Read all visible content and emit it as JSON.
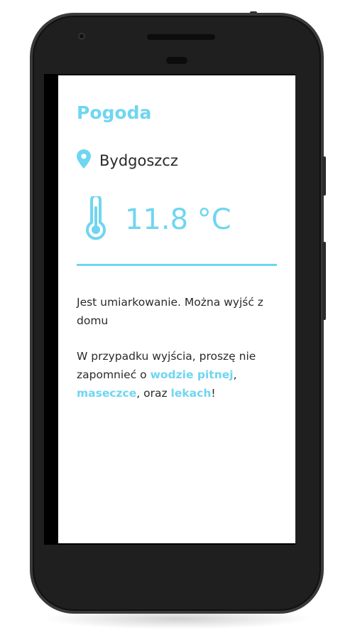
{
  "app": {
    "title": "Pogoda",
    "accent_color": "#6fd6f0"
  },
  "location": {
    "icon": "map-pin-icon",
    "city": "Bydgoszcz"
  },
  "weather": {
    "icon": "thermometer-icon",
    "temperature": "11.8 °C"
  },
  "advice": {
    "line1": "Jest umiarkowanie. Można wyjść z domu",
    "line2_part1": "W przypadku wyjścia, proszę nie zapomnieć o ",
    "item_water": "wodzie pitnej",
    "sep1": ", ",
    "item_mask": "maseczce",
    "sep2": ", oraz ",
    "item_meds": "lekach",
    "end": "!"
  }
}
